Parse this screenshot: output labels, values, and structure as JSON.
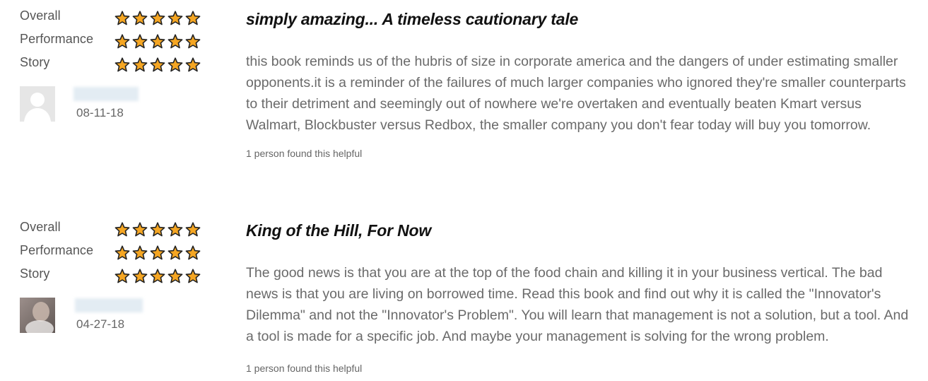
{
  "colors": {
    "star_fill": "#f5a623",
    "star_outline": "#222222",
    "title": "#111111",
    "body_text": "#6a6a6a"
  },
  "reviews": [
    {
      "ratings": [
        {
          "label": "Overall",
          "stars": 5,
          "max": 5
        },
        {
          "label": "Performance",
          "stars": 5,
          "max": 5
        },
        {
          "label": "Story",
          "stars": 5,
          "max": 5
        }
      ],
      "reviewer": {
        "avatar_icon": "default-user-silhouette-icon",
        "name": "",
        "date": "08-11-18"
      },
      "title": "simply amazing... A timeless cautionary tale",
      "body": "this book reminds us of the hubris of size in corporate america and the dangers of under estimating smaller opponents.it is a reminder of the failures of much larger companies who ignored they're smaller counterparts to their detriment and seemingly out of nowhere we're overtaken and eventually beaten Kmart versus Walmart, Blockbuster versus Redbox, the smaller company you don't fear today will buy you tomorrow.",
      "helpful": "1 person found this helpful"
    },
    {
      "ratings": [
        {
          "label": "Overall",
          "stars": 5,
          "max": 5
        },
        {
          "label": "Performance",
          "stars": 5,
          "max": 5
        },
        {
          "label": "Story",
          "stars": 5,
          "max": 5
        }
      ],
      "reviewer": {
        "avatar_icon": "user-photo-icon",
        "name": "",
        "date": "04-27-18"
      },
      "title": "King of the Hill, For Now",
      "body": "The good news is that you are at the top of the food chain and killing it in your business vertical. The bad news is that you are living on borrowed time. Read this book and find out why it is called the \"Innovator's Dilemma\" and not the \"Innovator's Problem\". You will learn that management is not a solution, but a tool. And a tool is made for a specific job. And maybe your management is solving for the wrong problem.",
      "helpful": "1 person found this helpful"
    }
  ]
}
